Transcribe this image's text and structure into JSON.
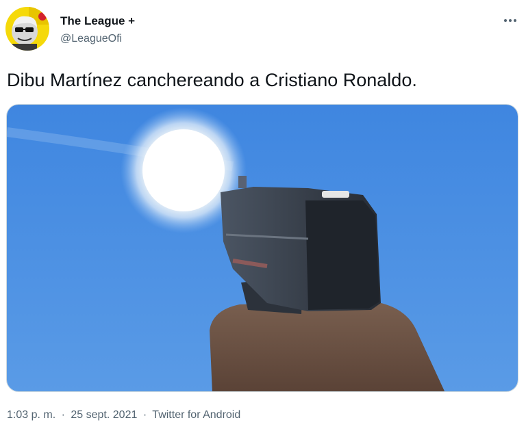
{
  "tweet": {
    "author": {
      "display_name": "The League +",
      "handle": "@LeagueOfi",
      "avatar_icon": "avatar-cartoon-icon"
    },
    "more_icon": "more-options-icon",
    "text": "Dibu Martínez canchereando a Cristiano Ronaldo.",
    "media": {
      "kind": "photo",
      "content": "hand-pointing-pistol-at-sun"
    },
    "meta": {
      "time": "1:03 p. m.",
      "separator": "·",
      "date": "25 sept. 2021",
      "source": "Twitter for Android"
    }
  },
  "colors": {
    "text_primary": "#0f1419",
    "text_secondary": "#536471",
    "sky": "#4a8ee0"
  }
}
